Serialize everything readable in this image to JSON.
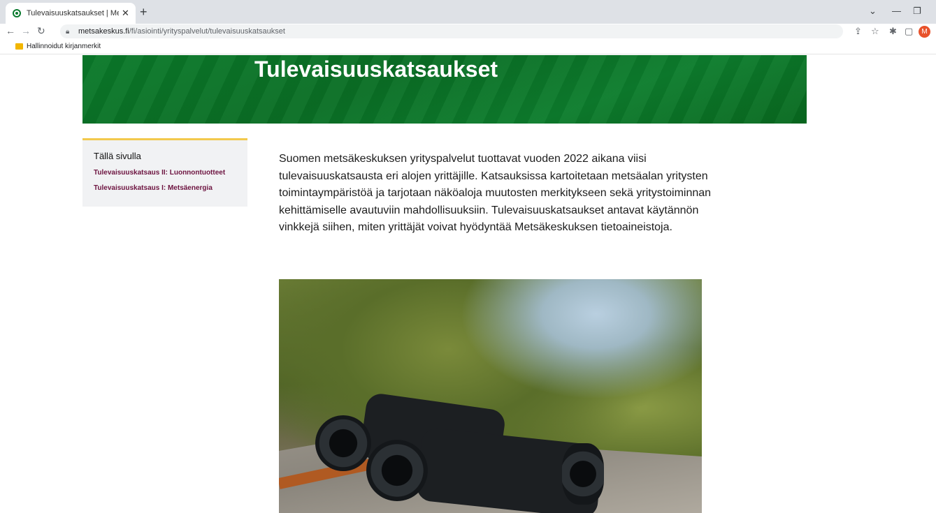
{
  "browser": {
    "tab_title": "Tulevaisuuskatsaukset | Metsäkes",
    "tab_close": "✕",
    "new_tab": "+",
    "url_host": "metsakeskus.fi",
    "url_path": "/fi/asiointi/yrityspalvelut/tulevaisuuskatsaukset",
    "bookmark_folder": "Hallinnoidut kirjanmerkit",
    "profile_initial": "M",
    "icons": [
      "back-icon",
      "forward-icon",
      "reload-icon",
      "lock-icon",
      "share-icon",
      "star-icon",
      "extensions-icon",
      "sidepanel-icon"
    ]
  },
  "hero": {
    "title": "Tulevaisuuskatsaukset",
    "color": "#0b7a2a"
  },
  "sidebar": {
    "heading": "Tällä sivulla",
    "links": [
      "Tulevaisuuskatsaus II: Luonnontuotteet",
      "Tulevaisuuskatsaus I: Metsäenergia"
    ],
    "accent": "#f2c94c",
    "link_color": "#6d1440"
  },
  "main": {
    "intro": "Suomen metsäkeskuksen yrityspalvelut tuottavat vuoden 2022 aikana viisi tulevaisuuskatsausta eri alojen yrittäjille. Katsauksissa kartoitetaan metsäalan yritysten toimintaympäristöä ja tarjotaan näköaloja muutosten merkitykseen sekä yritystoiminnan kehittämiselle avautuviin mahdollisuuksiin. Tulevaisuuskatsaukset antavat käytännön vinkkejä siihen, miten yrittäjät voivat hyödyntää Metsäkeskuksen tietoaineistoja."
  }
}
